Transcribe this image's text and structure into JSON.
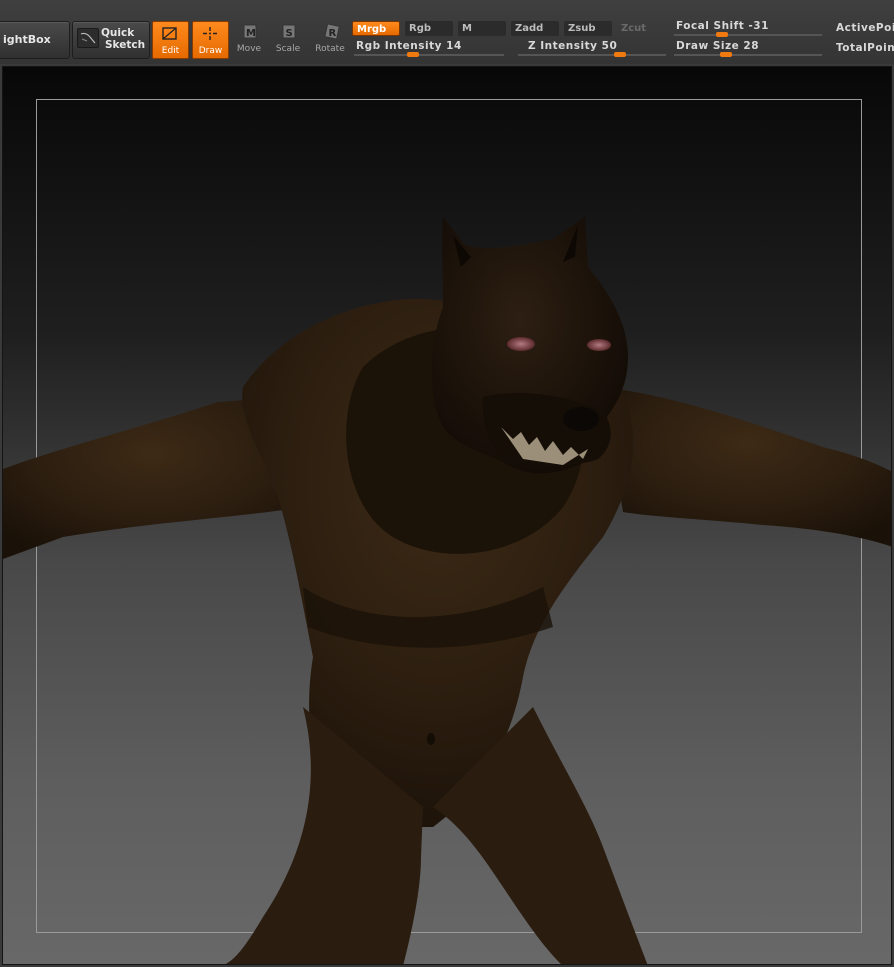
{
  "toolbar": {
    "lightbox_label": "ightBox",
    "quick_sketch": {
      "line1": "Quick",
      "line2": "Sketch"
    },
    "tools": {
      "edit": "Edit",
      "draw": "Draw",
      "move": "Move",
      "scale": "Scale",
      "rotate": "Rotate"
    },
    "modes": {
      "mrgb": "Mrgb",
      "rgb": "Rgb",
      "m": "M",
      "zadd": "Zadd",
      "zsub": "Zsub",
      "zcut": "Zcut"
    },
    "sliders": {
      "rgb_intensity": {
        "label": "Rgb  Intensity 14",
        "value": 14
      },
      "z_intensity": {
        "label": "Z  Intensity 50",
        "value": 50
      },
      "focal_shift": {
        "label": "Focal  Shift -31",
        "value": -31
      },
      "draw_size": {
        "label": "Draw  Size 28",
        "value": 28
      }
    },
    "stats": {
      "active_points": "ActivePoin",
      "total_points": "TotalPoint"
    }
  },
  "colors": {
    "accent": "#f07a10",
    "fur_dark": "#2a1c0f",
    "fur_mid": "#3b2814"
  }
}
